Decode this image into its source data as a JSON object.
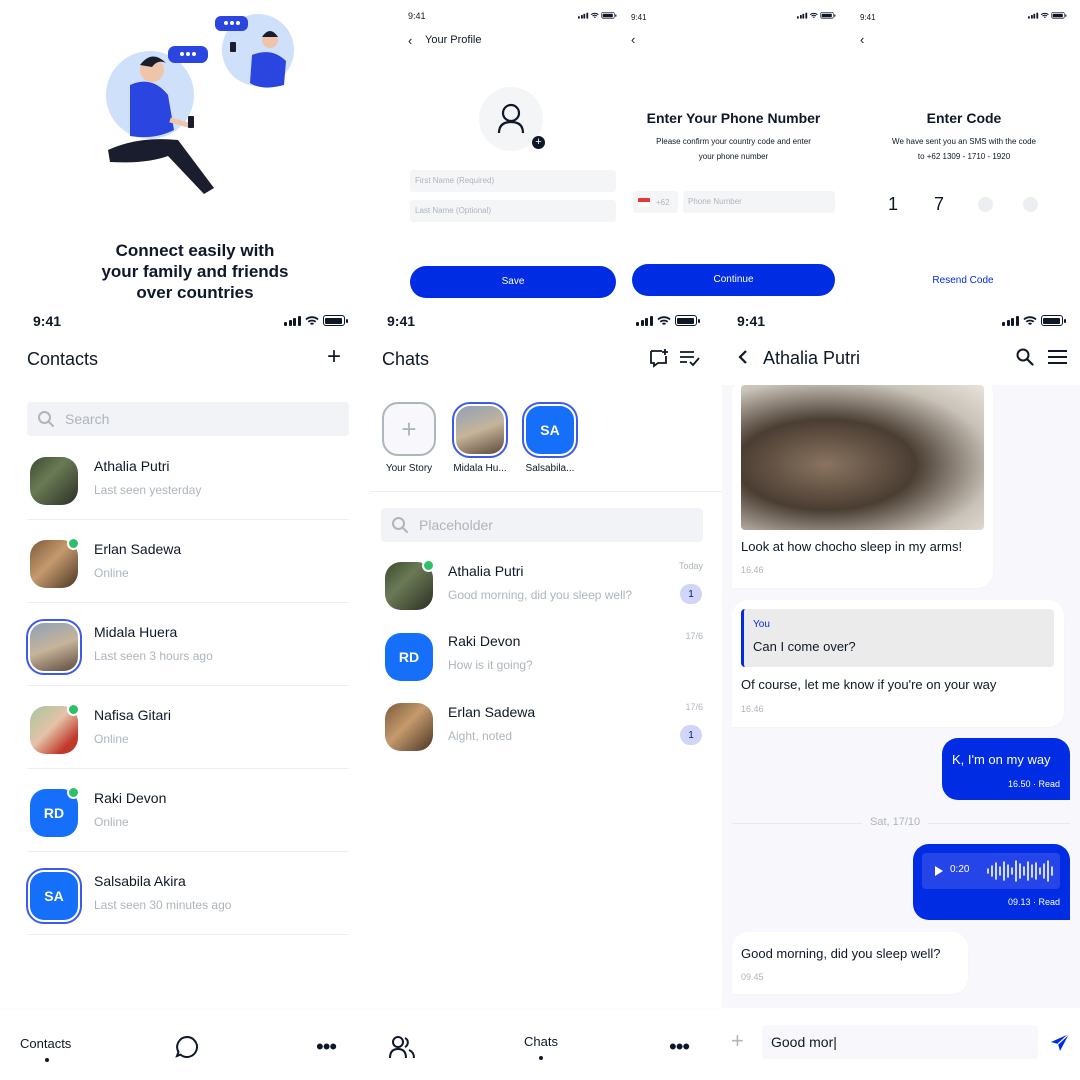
{
  "onboarding": {
    "headline_line1": "Connect easily with",
    "headline_line2": "your family and friends",
    "headline_line3": "over countries"
  },
  "profile_screen": {
    "time": "9:41",
    "title": "Your Profile",
    "first_name_placeholder": "First Name (Required)",
    "last_name_placeholder": "Last Name (Optional)",
    "save_label": "Save"
  },
  "phone_screen": {
    "time": "9:41",
    "title": "Enter Your Phone Number",
    "subtitle_line1": "Please confirm your country code and enter",
    "subtitle_line2": "your phone number",
    "country_code": "+62",
    "phone_placeholder": "Phone Number",
    "continue_label": "Continue"
  },
  "code_screen": {
    "time": "9:41",
    "title": "Enter Code",
    "subtitle_line1": "We have sent you an SMS with the code",
    "subtitle_line2": "to +62 1309 - 1710 - 1920",
    "digit1": "1",
    "digit2": "7",
    "resend_label": "Resend Code"
  },
  "contacts_screen": {
    "time": "9:41",
    "title": "Contacts",
    "add_icon": "plus-icon",
    "search_placeholder": "Search",
    "contacts": [
      {
        "name": "Athalia Putri",
        "status": "Last seen yesterday"
      },
      {
        "name": "Erlan Sadewa",
        "status": "Online"
      },
      {
        "name": "Midala Huera",
        "status": "Last seen 3 hours ago"
      },
      {
        "name": "Nafisa Gitari",
        "status": "Online"
      },
      {
        "name": "Raki Devon",
        "status": "Online",
        "initials": "RD"
      },
      {
        "name": "Salsabila Akira",
        "status": "Last seen 30 minutes ago",
        "initials": "SA"
      }
    ],
    "nav_contacts_label": "Contacts"
  },
  "chats_screen": {
    "time": "9:41",
    "title": "Chats",
    "stories": [
      {
        "label": "Your Story"
      },
      {
        "label": "Midala Hu..."
      },
      {
        "label": "Salsabila...",
        "initials": "SA"
      }
    ],
    "search_placeholder": "Placeholder",
    "chats": [
      {
        "name": "Athalia Putri",
        "preview": "Good morning, did you sleep well?",
        "date": "Today",
        "unread": "1"
      },
      {
        "name": "Raki Devon",
        "preview": "How is it going?",
        "date": "17/6",
        "initials": "RD"
      },
      {
        "name": "Erlan Sadewa",
        "preview": "Aight, noted",
        "date": "17/6",
        "unread": "1"
      }
    ],
    "nav_chats_label": "Chats"
  },
  "conversation_screen": {
    "time": "9:41",
    "contact_name": "Athalia Putri",
    "msg1_text": "Look at how chocho sleep in my arms!",
    "msg1_time": "16.46",
    "msg2_reply_author": "You",
    "msg2_reply_text": "Can I come over?",
    "msg2_text": "Of course, let me know if you're on your way",
    "msg2_time": "16.46",
    "msg3_text": "K, I'm on my way",
    "msg3_meta": "16.50 · Read",
    "date_separator": "Sat, 17/10",
    "voice_duration": "0:20",
    "voice_meta": "09.13 · Read",
    "msg5_text": "Good morning, did you sleep well?",
    "msg5_time": "09.45",
    "input_value": "Good mor|"
  },
  "colors": {
    "primary": "#002de3",
    "accent_blue": "#166ff8",
    "online": "#2cc069",
    "badge_bg": "#d2d5f9"
  }
}
